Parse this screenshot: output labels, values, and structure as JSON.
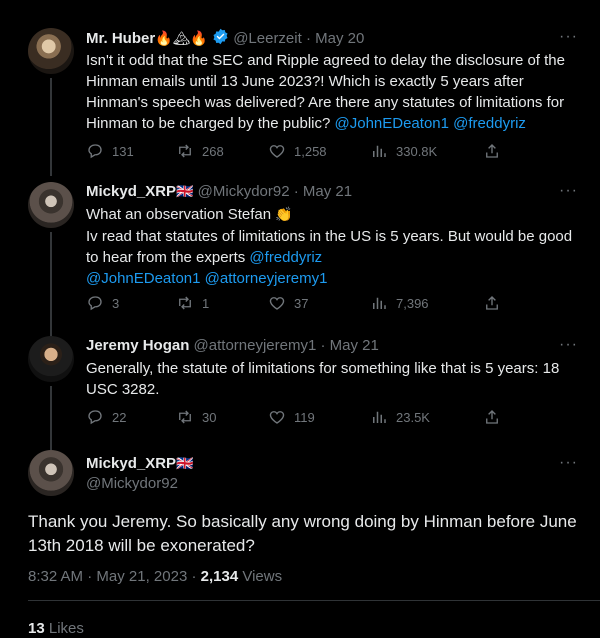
{
  "tweets": [
    {
      "name": "Mr. Huber",
      "handle": "@Leerzeit",
      "date": "May 20",
      "body_lines": [
        "Isn't it odd that the SEC and Ripple agreed to delay the disclosure of the",
        "Hinman emails until 13 June 2023?! Which is exactly 5 years after",
        "Hinman's speech was delivered? Are there any statutes of limitations for",
        "Hinman to be charged by the public?"
      ],
      "mentions": [
        "@JohnEDeaton1",
        "@freddyriz"
      ],
      "replies": "131",
      "retweets": "268",
      "likes": "1,258",
      "views": "330.8K"
    },
    {
      "name": "Mickyd_XRP",
      "handle": "@Mickydor92",
      "date": "May 21",
      "body_lines": [
        "What an observation Stefan",
        "Iv read that statutes of limitations in the US is 5 years. But would be good",
        "to hear from the experts"
      ],
      "mention_a": "@freddyriz",
      "mentions_b": [
        "@JohnEDeaton1",
        "@attorneyjeremy1"
      ],
      "replies": "3",
      "retweets": "1",
      "likes": "37",
      "views": "7,396"
    },
    {
      "name": "Jeremy Hogan",
      "handle": "@attorneyjeremy1",
      "date": "May 21",
      "body_lines": [
        "Generally, the statute of limitations for something like that is 5 years: 18",
        "USC 3282."
      ],
      "replies": "22",
      "retweets": "30",
      "likes": "119",
      "views": "23.5K"
    }
  ],
  "focused": {
    "name": "Mickyd_XRP",
    "handle": "@Mickydor92",
    "body_lines": [
      "Thank you Jeremy. So basically any wrong doing by Hinman before June",
      "13th 2018 will be exonerated?"
    ],
    "time": "8:32 AM",
    "date": "May 21, 2023",
    "views_count": "2,134",
    "views_label": "Views",
    "likes_count": "13",
    "likes_label": "Likes"
  },
  "separator": "·",
  "more_glyph": "···",
  "colors": {
    "background": "#000000",
    "text": "#e7e9ea",
    "muted": "#71767b",
    "link": "#1d9bf0",
    "verified": "#1d9bf0"
  }
}
